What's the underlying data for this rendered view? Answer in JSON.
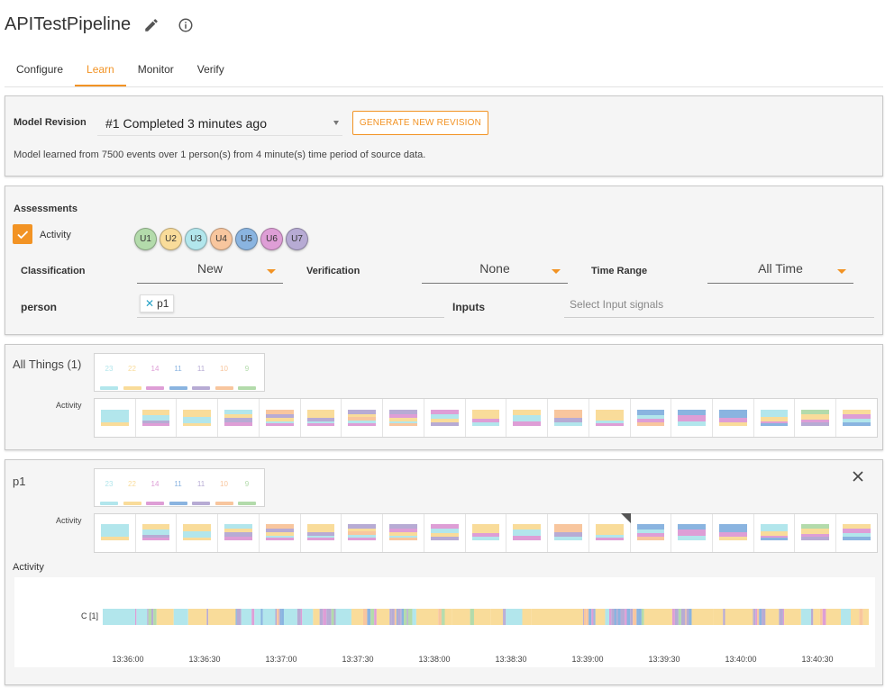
{
  "header": {
    "title": "APITestPipeline",
    "edit_icon": "pencil-icon",
    "info_icon": "info-icon"
  },
  "tabs": [
    {
      "label": "Configure",
      "active": false
    },
    {
      "label": "Learn",
      "active": true
    },
    {
      "label": "Monitor",
      "active": false
    },
    {
      "label": "Verify",
      "active": false
    }
  ],
  "model": {
    "label": "Model Revision",
    "selected": "#1 Completed 3 minutes ago",
    "generate_label": "GENERATE NEW REVISION",
    "info": "Model learned from 7500 events over 1 person(s) from 4 minute(s) time period of source data."
  },
  "assessments": {
    "title": "Assessments",
    "activity_label": "Activity",
    "activity_checked": true,
    "legend": [
      {
        "label": "U1",
        "color": "#b3dbab"
      },
      {
        "label": "U2",
        "color": "#f9dc9a"
      },
      {
        "label": "U3",
        "color": "#b2e6ec"
      },
      {
        "label": "U4",
        "color": "#f8c69e"
      },
      {
        "label": "U5",
        "color": "#8ab4e0"
      },
      {
        "label": "U6",
        "color": "#de9ed6"
      },
      {
        "label": "U7",
        "color": "#b7abd4"
      }
    ],
    "classification": {
      "label": "Classification",
      "value": "New"
    },
    "verification": {
      "label": "Verification",
      "value": "None"
    },
    "time_range": {
      "label": "Time Range",
      "value": "All Time"
    },
    "person": {
      "label": "person",
      "chip": "p1"
    },
    "inputs": {
      "label": "Inputs",
      "placeholder": "Select Input signals"
    }
  },
  "colors": {
    "accent": "#f29324",
    "U1": "#b3dbab",
    "U2": "#f9dc9a",
    "U3": "#b2e6ec",
    "U4": "#f8c69e",
    "U5": "#8ab4e0",
    "U6": "#de9ed6",
    "U7": "#b7abd4"
  },
  "counts": [
    {
      "value": "23",
      "color": "#b2e6ec"
    },
    {
      "value": "22",
      "color": "#f9dc9a"
    },
    {
      "value": "14",
      "color": "#de9ed6"
    },
    {
      "value": "11",
      "color": "#8ab4e0"
    },
    {
      "value": "11",
      "color": "#b7abd4"
    },
    {
      "value": "10",
      "color": "#f8c69e"
    },
    {
      "value": "9",
      "color": "#b3dbab"
    }
  ],
  "all_things": {
    "title": "All Things (1)",
    "row_label": "Activity"
  },
  "p1_group": {
    "title": "p1",
    "row_label": "Activity",
    "timeline_title": "Activity",
    "timeline_row_label": "C [1]",
    "close_icon": "close-icon"
  },
  "timeline_ticks": [
    "13:36:00",
    "13:36:30",
    "13:37:00",
    "13:37:30",
    "13:38:00",
    "13:38:30",
    "13:39:00",
    "13:39:30",
    "13:40:00",
    "13:40:30"
  ],
  "histogram_cells": [
    [
      [
        "U3",
        0.8
      ],
      [
        "U2",
        0.2
      ]
    ],
    [
      [
        "U2",
        0.35
      ],
      [
        "U3",
        0.3
      ],
      [
        "U7",
        0.2
      ],
      [
        "U6",
        0.15
      ]
    ],
    [
      [
        "U2",
        0.45
      ],
      [
        "U3",
        0.4
      ],
      [
        "U2",
        0.15
      ]
    ],
    [
      [
        "U3",
        0.3
      ],
      [
        "U2",
        0.2
      ],
      [
        "U7",
        0.25
      ],
      [
        "U6",
        0.25
      ]
    ],
    [
      [
        "U4",
        0.3
      ],
      [
        "U7",
        0.2
      ],
      [
        "U2",
        0.2
      ],
      [
        "U3",
        0.15
      ],
      [
        "U6",
        0.15
      ]
    ],
    [
      [
        "U2",
        0.5
      ],
      [
        "U7",
        0.2
      ],
      [
        "U3",
        0.15
      ],
      [
        "U6",
        0.15
      ]
    ],
    [
      [
        "U7",
        0.25
      ],
      [
        "U2",
        0.2
      ],
      [
        "U4",
        0.2
      ],
      [
        "U3",
        0.2
      ],
      [
        "U6",
        0.15
      ]
    ],
    [
      [
        "U7",
        0.3
      ],
      [
        "U6",
        0.2
      ],
      [
        "U2",
        0.2
      ],
      [
        "U3",
        0.15
      ],
      [
        "U4",
        0.15
      ]
    ],
    [
      [
        "U6",
        0.3
      ],
      [
        "U3",
        0.25
      ],
      [
        "U2",
        0.25
      ],
      [
        "U7",
        0.2
      ]
    ],
    [
      [
        "U2",
        0.55
      ],
      [
        "U6",
        0.2
      ],
      [
        "U3",
        0.25
      ]
    ],
    [
      [
        "U2",
        0.35
      ],
      [
        "U3",
        0.35
      ],
      [
        "U6",
        0.3
      ]
    ],
    [
      [
        "U4",
        0.5
      ],
      [
        "U7",
        0.3
      ],
      [
        "U3",
        0.2
      ]
    ],
    [
      [
        "U2",
        0.65
      ],
      [
        "U3",
        0.2
      ],
      [
        "U6",
        0.15
      ]
    ],
    [
      [
        "U5",
        0.35
      ],
      [
        "U3",
        0.2
      ],
      [
        "U6",
        0.25
      ],
      [
        "U4",
        0.2
      ]
    ],
    [
      [
        "U5",
        0.35
      ],
      [
        "U6",
        0.35
      ],
      [
        "U3",
        0.3
      ]
    ],
    [
      [
        "U5",
        0.5
      ],
      [
        "U6",
        0.25
      ],
      [
        "U2",
        0.25
      ]
    ],
    [
      [
        "U3",
        0.45
      ],
      [
        "U2",
        0.25
      ],
      [
        "U6",
        0.15
      ],
      [
        "U5",
        0.15
      ]
    ],
    [
      [
        "U1",
        0.3
      ],
      [
        "U2",
        0.3
      ],
      [
        "U6",
        0.2
      ],
      [
        "U7",
        0.2
      ]
    ],
    [
      [
        "U2",
        0.3
      ],
      [
        "U6",
        0.25
      ],
      [
        "U3",
        0.25
      ],
      [
        "U5",
        0.2
      ]
    ]
  ],
  "marked_cell": 12
}
